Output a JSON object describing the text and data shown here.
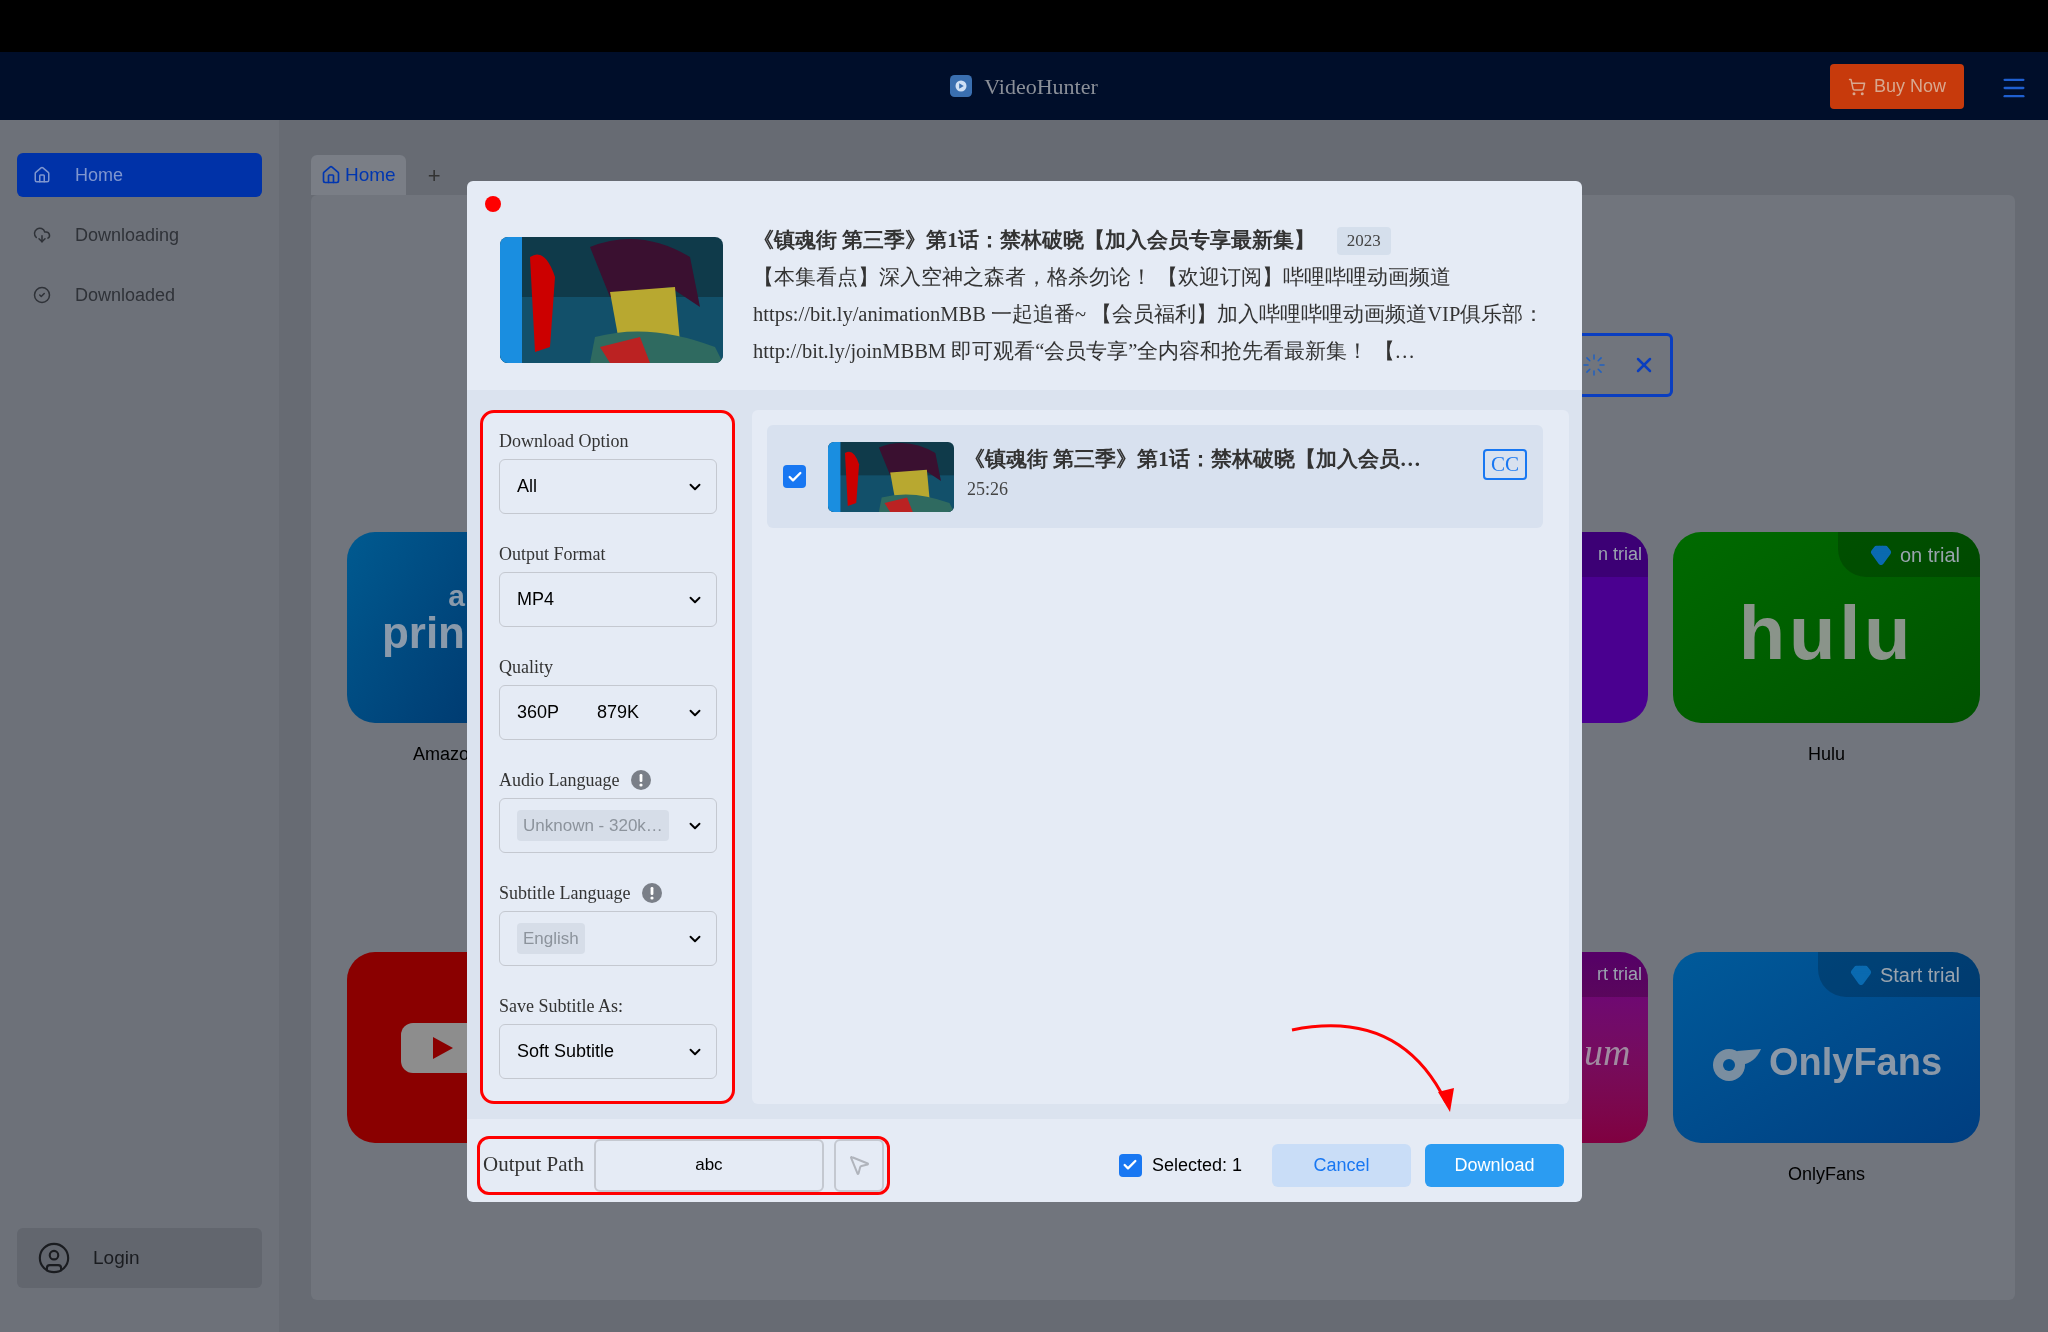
{
  "window": {
    "title": "VideoHunter",
    "buy_button": "Buy Now"
  },
  "sidebar": {
    "items": [
      {
        "label": "Home",
        "selected": true
      },
      {
        "label": "Downloading",
        "selected": false
      },
      {
        "label": "Downloaded",
        "selected": false
      }
    ],
    "login": "Login"
  },
  "tabs": [
    {
      "label": "Home",
      "selected": true
    }
  ],
  "new_tab": "+",
  "services": [
    {
      "kind": "prime",
      "logo_small": "a",
      "logo": "prin",
      "label": "Amazo"
    },
    {
      "kind": "youtube"
    },
    {
      "kind": "purple",
      "badge": "n trial"
    },
    {
      "kind": "magenta",
      "badge": "rt trial",
      "logo": "um"
    },
    {
      "kind": "hulu",
      "badge": "on trial",
      "logo": "hulu",
      "label": "Hulu"
    },
    {
      "kind": "onlyfans",
      "badge": "Start trial",
      "logo": "OnlyFans",
      "label": "OnlyFans"
    }
  ],
  "dialog": {
    "title": "《镇魂街 第三季》第1话：禁林破晓【加入会员专享最新集】",
    "year": "2023",
    "description": "【本集看点】深入空神之森者，格杀勿论！ 【欢迎订阅】哔哩哔哩动画频道 https://bit.ly/animationMBB 一起追番~ 【会员福利】加入哔哩哔哩动画频道VIP俱乐部：http://bit.ly/joinMBBM 即可观看“会员专享”全内容和抢先看最新集！ 【…",
    "fields": [
      {
        "label": "Download Option",
        "value": "All",
        "info": false,
        "disabled": false
      },
      {
        "label": "Output Format",
        "value": "MP4",
        "info": false,
        "disabled": false
      },
      {
        "label": "Quality",
        "value": "360P",
        "bitrate": "879K",
        "info": false,
        "disabled": false
      },
      {
        "label": "Audio Language",
        "value": "Unknown - 320k…",
        "info": true,
        "disabled": true
      },
      {
        "label": "Subtitle Language",
        "value": "English",
        "info": true,
        "disabled": true
      },
      {
        "label": "Save Subtitle As:",
        "value": "Soft Subtitle",
        "info": false,
        "disabled": false
      }
    ],
    "items": [
      {
        "checked": true,
        "title": "《镇魂街 第三季》第1话：禁林破晓【加入会员…",
        "duration": "25:26",
        "badge": "CC"
      }
    ],
    "output_path": {
      "label": "Output Path",
      "value": "abc"
    },
    "select_all": {
      "checked": true,
      "label": "Selected: 1"
    },
    "buttons": [
      "Cancel",
      "Download"
    ]
  }
}
